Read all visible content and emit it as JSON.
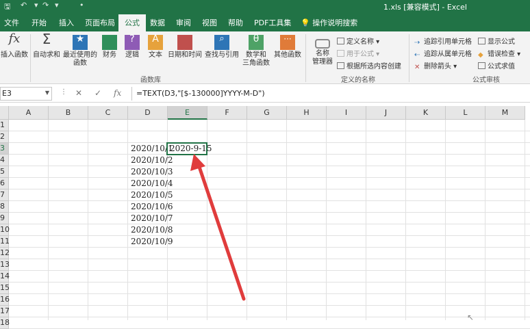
{
  "title_bar": {
    "window_title": "1.xls [兼容模式] - Excel"
  },
  "tabs": [
    {
      "label": "文件"
    },
    {
      "label": "开始"
    },
    {
      "label": "插入"
    },
    {
      "label": "页面布局"
    },
    {
      "label": "公式",
      "active": true
    },
    {
      "label": "数据"
    },
    {
      "label": "审阅"
    },
    {
      "label": "视图"
    },
    {
      "label": "帮助"
    },
    {
      "label": "PDF工具集"
    }
  ],
  "search": {
    "placeholder": "操作说明搜索"
  },
  "ribbon": {
    "insert_function": "插入函数",
    "autosum": "自动求和",
    "recent": [
      "最近使用的",
      "函数"
    ],
    "financial": "财务",
    "logical": "逻辑",
    "text": "文本",
    "datetime": "日期和时间",
    "lookup": "查找与引用",
    "math": [
      "数学和",
      "三角函数"
    ],
    "more": "其他函数",
    "group_library": "函数库",
    "name_manager": [
      "名称",
      "管理器"
    ],
    "define_name": "定义名称",
    "use_in_formula": "用于公式",
    "create_from_selection": "根据所选内容创建",
    "group_defined_names": "定义的名称",
    "trace_precedents": "追踪引用单元格",
    "trace_dependents": "追踪从属单元格",
    "remove_arrows": "删除箭头",
    "show_formulas": "显示公式",
    "error_checking": "错误检查",
    "evaluate_formula": "公式求值",
    "group_auditing": "公式审核"
  },
  "formula_bar": {
    "name_box": "E3",
    "formula": "=TEXT(D3,\"[$-130000]YYYY-M-D\")"
  },
  "columns": [
    "A",
    "B",
    "C",
    "D",
    "E",
    "F",
    "G",
    "H",
    "I",
    "J",
    "K",
    "L",
    "M"
  ],
  "rows": [
    "1",
    "2",
    "3",
    "4",
    "5",
    "6",
    "7",
    "8",
    "9",
    "10",
    "11",
    "12",
    "13",
    "14",
    "15",
    "16",
    "17",
    "18"
  ],
  "cells": {
    "D": [
      "2020/10/1",
      "2020/10/2",
      "2020/10/3",
      "2020/10/4",
      "2020/10/5",
      "2020/10/6",
      "2020/10/7",
      "2020/10/8",
      "2020/10/9"
    ],
    "E3": "2020-9-15"
  },
  "colors": {
    "excel_green": "#217346",
    "arrow_red": "#e03c3c"
  }
}
